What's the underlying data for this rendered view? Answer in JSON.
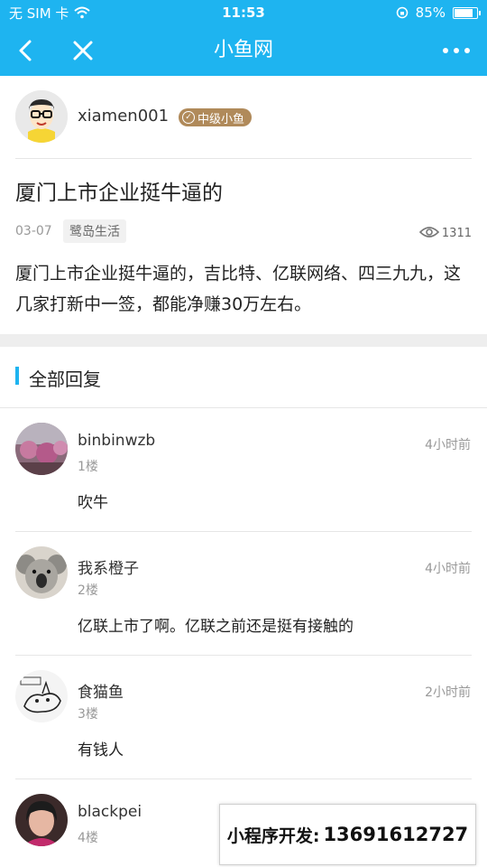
{
  "status_bar": {
    "carrier": "无 SIM 卡",
    "time": "11:53",
    "battery_percent": "85%",
    "battery_level": 0.85
  },
  "nav": {
    "title": "小鱼网",
    "back_icon": "chevron-left-icon",
    "close_icon": "close-icon",
    "more_icon": "more-dots-icon"
  },
  "post": {
    "author": "xiamen001",
    "author_level": "中级小鱼",
    "title": "厦门上市企业挺牛逼的",
    "date": "03-07",
    "tag": "鹭岛生活",
    "views": "1311",
    "body": "厦门上市企业挺牛逼的，吉比特、亿联网络、四三九九，这几家打新中一签，都能净赚30万左右。"
  },
  "replies_header": "全部回复",
  "replies": [
    {
      "name": "binbinwzb",
      "floor": "1楼",
      "time": "4小时前",
      "text": "吹牛"
    },
    {
      "name": "我系橙子",
      "floor": "2楼",
      "time": "4小时前",
      "text": "亿联上市了啊。亿联之前还是挺有接触的"
    },
    {
      "name": "食猫鱼",
      "floor": "3楼",
      "time": "2小时前",
      "text": "有钱人"
    },
    {
      "name": "blackpei",
      "floor": "4楼",
      "time": "",
      "text": ""
    }
  ],
  "promo": {
    "label": "小程序开发:",
    "phone": "13691612727"
  },
  "colors": {
    "brand": "#1eb4f0",
    "badge": "#b08a5a",
    "separator": "#eeeeee"
  }
}
